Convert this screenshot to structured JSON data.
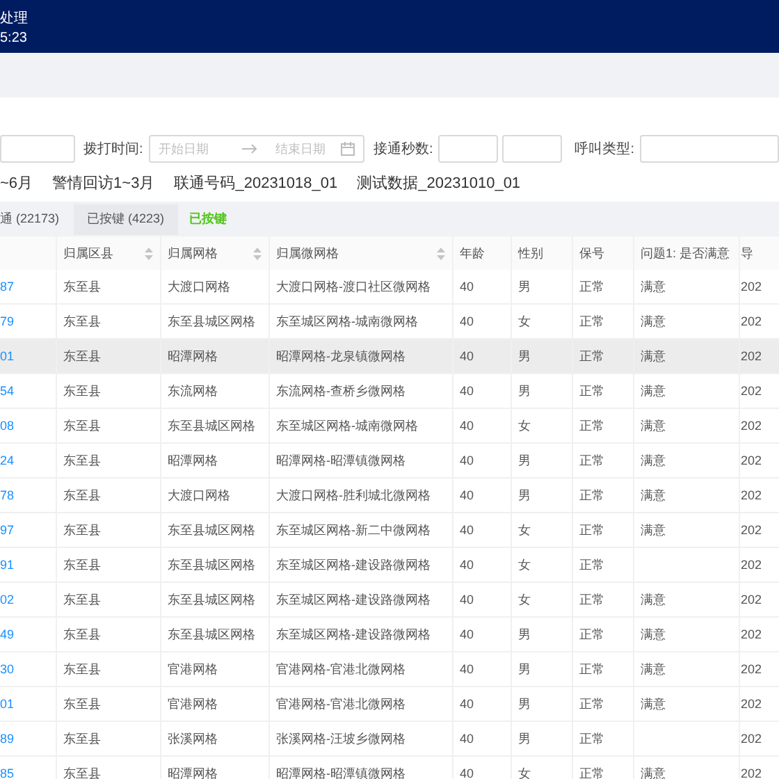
{
  "header": {
    "title": "处理",
    "time": "5:23"
  },
  "filters": [
    {
      "kind": "input"
    },
    {
      "kind": "daterange",
      "label": "拨打时间:",
      "start_placeholder": "开始日期",
      "end_placeholder": "结束日期"
    },
    {
      "kind": "pair",
      "label": "接通秒数:"
    },
    {
      "kind": "select",
      "label": "呼叫类型:"
    }
  ],
  "batches": [
    {
      "label": "~6月"
    },
    {
      "label": "警情回访1~3月"
    },
    {
      "label": "联通号码_20231018_01"
    },
    {
      "label": "测试数据_20231010_01"
    }
  ],
  "tabs": [
    {
      "label": "通 (22173)",
      "selected": false
    },
    {
      "label": "已按键 (4223)",
      "selected": true
    }
  ],
  "status_tag": "已按键",
  "table": {
    "columns": [
      {
        "sortable": false
      },
      {
        "label": "归属区县",
        "sortable": true
      },
      {
        "label": "归属网格",
        "sortable": true
      },
      {
        "label": "归属微网格",
        "sortable": true
      },
      {
        "label": "年龄",
        "sortable": false
      },
      {
        "label": "性别",
        "sortable": false
      },
      {
        "label": "保号",
        "sortable": false
      },
      {
        "label": "问题1: 是否满意",
        "sortable": false
      },
      {
        "label": "导",
        "sortable": false
      }
    ],
    "rows": [
      {
        "highlighted": false,
        "cells": [
          "87",
          "东至县",
          "大渡口网格",
          "大渡口网格-渡口社区微网格",
          "40",
          "男",
          "正常",
          "满意",
          "202"
        ]
      },
      {
        "highlighted": false,
        "cells": [
          "79",
          "东至县",
          "东至县城区网格",
          "东至城区网格-城南微网格",
          "40",
          "女",
          "正常",
          "满意",
          "202"
        ]
      },
      {
        "highlighted": true,
        "cells": [
          "01",
          "东至县",
          "昭潭网格",
          "昭潭网格-龙泉镇微网格",
          "40",
          "男",
          "正常",
          "满意",
          "202"
        ]
      },
      {
        "highlighted": false,
        "cells": [
          "54",
          "东至县",
          "东流网格",
          "东流网格-查桥乡微网格",
          "40",
          "男",
          "正常",
          "满意",
          "202"
        ]
      },
      {
        "highlighted": false,
        "cells": [
          "08",
          "东至县",
          "东至县城区网格",
          "东至城区网格-城南微网格",
          "40",
          "女",
          "正常",
          "满意",
          "202"
        ]
      },
      {
        "highlighted": false,
        "cells": [
          "24",
          "东至县",
          "昭潭网格",
          "昭潭网格-昭潭镇微网格",
          "40",
          "男",
          "正常",
          "满意",
          "202"
        ]
      },
      {
        "highlighted": false,
        "cells": [
          "78",
          "东至县",
          "大渡口网格",
          "大渡口网格-胜利城北微网格",
          "40",
          "男",
          "正常",
          "满意",
          "202"
        ]
      },
      {
        "highlighted": false,
        "cells": [
          "97",
          "东至县",
          "东至县城区网格",
          "东至城区网格-新二中微网格",
          "40",
          "女",
          "正常",
          "满意",
          "202"
        ]
      },
      {
        "highlighted": false,
        "cells": [
          "91",
          "东至县",
          "东至县城区网格",
          "东至城区网格-建设路微网格",
          "40",
          "女",
          "正常",
          "",
          "202"
        ]
      },
      {
        "highlighted": false,
        "cells": [
          "02",
          "东至县",
          "东至县城区网格",
          "东至城区网格-建设路微网格",
          "40",
          "女",
          "正常",
          "满意",
          "202"
        ]
      },
      {
        "highlighted": false,
        "cells": [
          "49",
          "东至县",
          "东至县城区网格",
          "东至城区网格-建设路微网格",
          "40",
          "男",
          "正常",
          "满意",
          "202"
        ]
      },
      {
        "highlighted": false,
        "cells": [
          "30",
          "东至县",
          "官港网格",
          "官港网格-官港北微网格",
          "40",
          "男",
          "正常",
          "满意",
          "202"
        ]
      },
      {
        "highlighted": false,
        "cells": [
          "01",
          "东至县",
          "官港网格",
          "官港网格-官港北微网格",
          "40",
          "男",
          "正常",
          "满意",
          "202"
        ]
      },
      {
        "highlighted": false,
        "cells": [
          "89",
          "东至县",
          "张溪网格",
          "张溪网格-汪坡乡微网格",
          "40",
          "男",
          "正常",
          "",
          "202"
        ]
      },
      {
        "highlighted": false,
        "cells": [
          "85",
          "东至县",
          "昭潭网格",
          "昭潭网格-昭潭镇微网格",
          "40",
          "女",
          "正常",
          "满意",
          "202"
        ]
      }
    ]
  }
}
